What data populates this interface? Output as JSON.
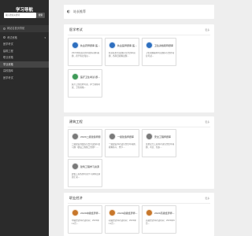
{
  "sidebar": {
    "logo": "学习导航",
    "search_placeholder": "输入搜索关键词",
    "search_button": "搜索",
    "items": [
      {
        "label": "网站名首页导航"
      },
      {
        "label": "考试资格"
      },
      {
        "label": "医学考试"
      },
      {
        "label": "建筑工程"
      },
      {
        "label": "职业资格"
      },
      {
        "label": "学业资格"
      },
      {
        "label": "高校题库"
      },
      {
        "label": "医学考试"
      }
    ]
  },
  "topbar": {
    "icon": "wechat-icon",
    "text": "站长推荐"
  },
  "sections": [
    {
      "title": "医学考试",
      "more": "更多",
      "cards": [
        {
          "name": "执业药师题库-医...",
          "desc": "2024年执业药师考题库资料真题、药学专业知识...",
          "icon_color": "blue"
        },
        {
          "name": "执业医师题库-医...",
          "desc": "执业医师考试题库包含历年真题、各科目模拟试题...",
          "icon_color": "blue"
        },
        {
          "name": "卫生资格职称题库",
          "desc": "卫生资格职称考试题库包含各专业考试...",
          "icon_color": "blue"
        },
        {
          "name": "医疗卫生考试-题...",
          "desc": "医疗卫生招聘考试、护士资格考试、卫生资格...",
          "icon_color": "green"
        }
      ]
    },
    {
      "title": "建筑工程",
      "more": "更多",
      "cards": [
        {
          "name": "2024二级建造师题",
          "desc": "二级建造师题库包含考试各科目习题《建设工程施工管理》...",
          "icon_color": "gray"
        },
        {
          "name": "一级建造师题库",
          "desc": "一级建造师考试包含历年真题、模拟练习、章节...",
          "icon_color": "gray"
        },
        {
          "name": "安全工程师题库",
          "desc": "注册安全工程师考试包含历年真题、考点、知识...",
          "icon_color": "gray"
        },
        {
          "name": "建筑工程学习资源",
          "desc": "建筑工程各类考试学习资料及资源汇总...",
          "icon_color": "gray"
        }
      ]
    },
    {
      "title": "职业经济",
      "more": "更多",
      "cards": [
        {
          "name": "2024中级经济师...",
          "desc": "中级经济师考试时间：2024年11月...",
          "icon_color": "orange"
        },
        {
          "name": "2024初级经济师...",
          "desc": "初级经济师考试时间：2024年11月...",
          "icon_color": "orange"
        },
        {
          "name": "2024高级经济师...",
          "desc": "高级经济师考试时间：2024年6月...",
          "icon_color": "orange"
        }
      ]
    }
  ]
}
